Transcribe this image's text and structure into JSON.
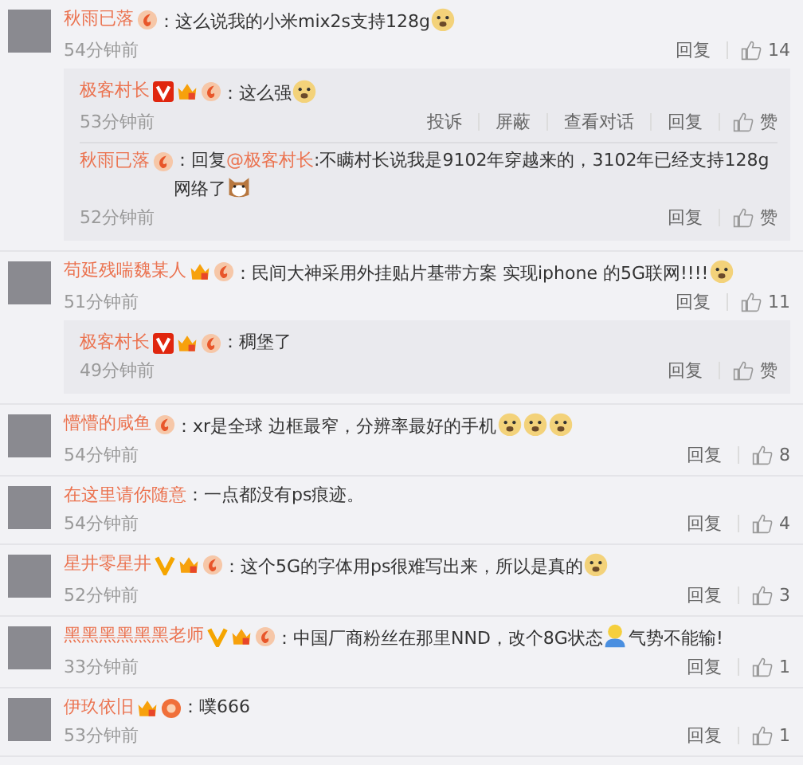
{
  "comments": [
    {
      "name": "秋雨已落",
      "badges": [
        {
          "kind": "flame"
        }
      ],
      "content": [
        {
          "kind": "text",
          "text": "：这么说我的小米mix2s支持128g"
        },
        {
          "kind": "doge"
        }
      ],
      "time": "54分钟前",
      "actions": [
        {
          "kind": "text",
          "label": "回复"
        },
        {
          "kind": "like",
          "label": "14"
        }
      ],
      "replies": [
        {
          "name": "极客村长",
          "badges": [
            {
              "kind": "v_red"
            },
            {
              "kind": "crown"
            },
            {
              "kind": "flame"
            }
          ],
          "content": [
            {
              "kind": "text",
              "text": "：这么强"
            },
            {
              "kind": "doge"
            }
          ],
          "time": "53分钟前",
          "actions": [
            {
              "kind": "text",
              "label": "投诉"
            },
            {
              "kind": "text",
              "label": "屏蔽"
            },
            {
              "kind": "text",
              "label": "查看对话"
            },
            {
              "kind": "text",
              "label": "回复"
            },
            {
              "kind": "like",
              "label": "赞"
            }
          ]
        },
        {
          "name": "秋雨已落",
          "badges": [
            {
              "kind": "flame"
            }
          ],
          "content": [
            {
              "kind": "text",
              "text": "：回复"
            },
            {
              "kind": "mention",
              "text": "@极客村长"
            },
            {
              "kind": "text",
              "text": ":不瞒村长说我是9102年穿越来的，3102年已经支持128g网络了"
            },
            {
              "kind": "cat"
            }
          ],
          "time": "52分钟前",
          "actions": [
            {
              "kind": "text",
              "label": "回复"
            },
            {
              "kind": "like",
              "label": "赞"
            }
          ]
        }
      ]
    },
    {
      "name": "苟延残喘魏某人",
      "badges": [
        {
          "kind": "crown"
        },
        {
          "kind": "flame"
        }
      ],
      "content": [
        {
          "kind": "text",
          "text": "：民间大神采用外挂贴片基带方案 实现iphone 的5G联网!!!!"
        },
        {
          "kind": "doge"
        }
      ],
      "time": "51分钟前",
      "actions": [
        {
          "kind": "text",
          "label": "回复"
        },
        {
          "kind": "like",
          "label": "11"
        }
      ],
      "replies": [
        {
          "name": "极客村长",
          "badges": [
            {
              "kind": "v_red"
            },
            {
              "kind": "crown"
            },
            {
              "kind": "flame"
            }
          ],
          "content": [
            {
              "kind": "text",
              "text": "：稠堡了"
            }
          ],
          "time": "49分钟前",
          "actions": [
            {
              "kind": "text",
              "label": "回复"
            },
            {
              "kind": "like",
              "label": "赞"
            }
          ]
        }
      ]
    },
    {
      "name": "懵懵的咸鱼",
      "badges": [
        {
          "kind": "flame"
        }
      ],
      "content": [
        {
          "kind": "text",
          "text": "：xr是全球 边框最窄，分辨率最好的手机"
        },
        {
          "kind": "doge"
        },
        {
          "kind": "doge"
        },
        {
          "kind": "doge"
        }
      ],
      "time": "54分钟前",
      "actions": [
        {
          "kind": "text",
          "label": "回复"
        },
        {
          "kind": "like",
          "label": "8"
        }
      ]
    },
    {
      "name": "在这里请你随意",
      "content": [
        {
          "kind": "text",
          "text": "：一点都没有ps痕迹。"
        }
      ],
      "time": "54分钟前",
      "actions": [
        {
          "kind": "text",
          "label": "回复"
        },
        {
          "kind": "like",
          "label": "4"
        }
      ]
    },
    {
      "name": "星井零星井",
      "badges": [
        {
          "kind": "v_yellow"
        },
        {
          "kind": "crown"
        },
        {
          "kind": "flame"
        }
      ],
      "content": [
        {
          "kind": "text",
          "text": "：这个5G的字体用ps很难写出来，所以是真的"
        },
        {
          "kind": "doge"
        }
      ],
      "time": "52分钟前",
      "actions": [
        {
          "kind": "text",
          "label": "回复"
        },
        {
          "kind": "like",
          "label": "3"
        }
      ]
    },
    {
      "name": "黑黑黑黑黑黑老师",
      "badges": [
        {
          "kind": "v_yellow"
        },
        {
          "kind": "crown"
        },
        {
          "kind": "flame"
        }
      ],
      "content": [
        {
          "kind": "text",
          "text": "：中国厂商粉丝在那里NND，改个8G状态"
        },
        {
          "kind": "person"
        },
        {
          "kind": "text",
          "text": "气势不能输!"
        }
      ],
      "time": "33分钟前",
      "actions": [
        {
          "kind": "text",
          "label": "回复"
        },
        {
          "kind": "like",
          "label": "1"
        }
      ]
    },
    {
      "name": "伊玖依旧",
      "badges": [
        {
          "kind": "crown"
        },
        {
          "kind": "circle"
        }
      ],
      "content": [
        {
          "kind": "text",
          "text": "：噗666"
        }
      ],
      "time": "53分钟前",
      "actions": [
        {
          "kind": "text",
          "label": "回复"
        },
        {
          "kind": "like",
          "label": "1"
        }
      ]
    }
  ]
}
